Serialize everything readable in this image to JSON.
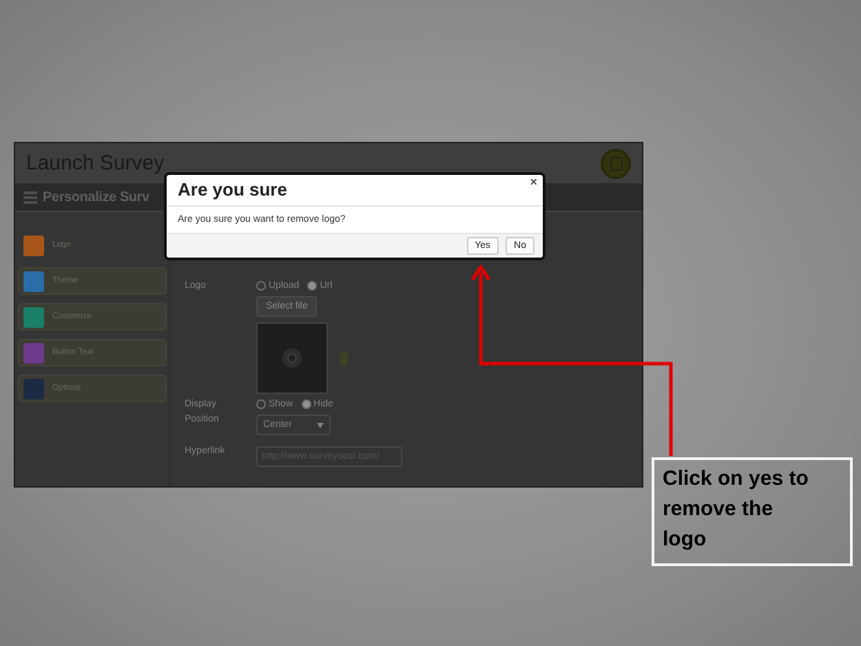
{
  "screenshot": {
    "title": "Launch Survey",
    "section_title": "Personalize Surv",
    "sidebar": [
      {
        "label": "Logo",
        "color": "#a8561a",
        "selected": true
      },
      {
        "label": "Theme",
        "color": "#2a6ea8",
        "selected": false
      },
      {
        "label": "Customize",
        "color": "#1a8068",
        "selected": false
      },
      {
        "label": "Button Text",
        "color": "#6e3a8c",
        "selected": false
      },
      {
        "label": "Options",
        "color": "#1c2a44",
        "selected": false
      }
    ],
    "form": {
      "logo_label": "Logo",
      "logo_source": [
        {
          "label": "Upload",
          "selected": false
        },
        {
          "label": "Url",
          "selected": true
        }
      ],
      "select_file_button": "Select file",
      "display_label": "Display",
      "display": [
        {
          "label": "Show",
          "selected": false
        },
        {
          "label": "Hide",
          "selected": true
        }
      ],
      "position_label": "Position",
      "position_value": "Center",
      "hyperlink_label": "Hyperlink",
      "hyperlink_value": "http://www.surveyoost.com/"
    }
  },
  "dialog": {
    "title": "Are you sure",
    "close": "×",
    "message": "Are you sure you want to remove logo?",
    "buttons": [
      "Yes",
      "No"
    ]
  },
  "callout": {
    "text": "Click on yes to remove the logo"
  }
}
